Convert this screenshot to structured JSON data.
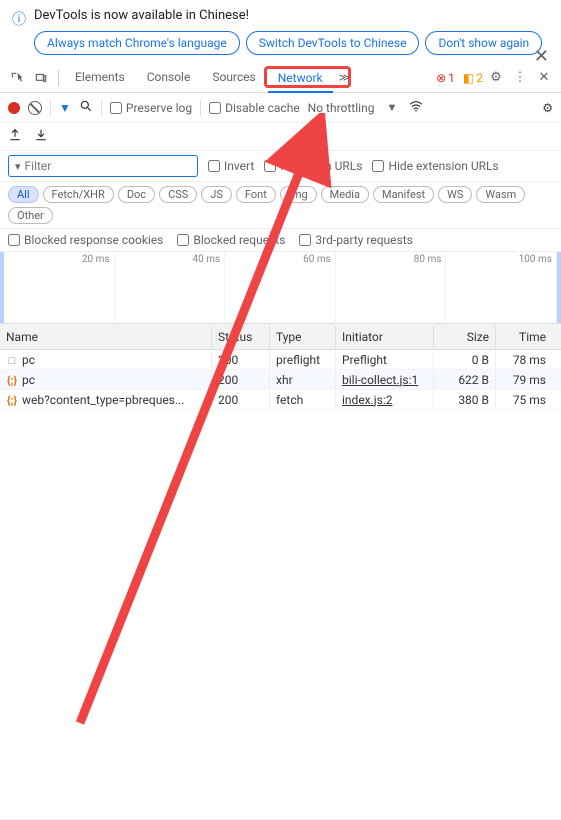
{
  "infobar": {
    "message": "DevTools is now available in Chinese!",
    "chips": [
      "Always match Chrome's language",
      "Switch DevTools to Chinese",
      "Don't show again"
    ]
  },
  "tabs": {
    "items": [
      "Elements",
      "Console",
      "Sources",
      "Network"
    ],
    "active": 3,
    "errors": "1",
    "warnings": "2"
  },
  "toolbar": {
    "preserve_log": "Preserve log",
    "disable_cache": "Disable cache",
    "throttling": "No throttling"
  },
  "filter": {
    "placeholder": "Filter",
    "invert": "Invert",
    "hide_data_urls": "Hide data URLs",
    "hide_ext_urls": "Hide extension URLs"
  },
  "types": [
    "All",
    "Fetch/XHR",
    "Doc",
    "CSS",
    "JS",
    "Font",
    "Img",
    "Media",
    "Manifest",
    "WS",
    "Wasm",
    "Other"
  ],
  "options": {
    "blocked_cookies": "Blocked response cookies",
    "blocked_requests": "Blocked requests",
    "third_party": "3rd-party requests"
  },
  "timeline": [
    "20 ms",
    "40 ms",
    "60 ms",
    "80 ms",
    "100 ms"
  ],
  "headers": {
    "name": "Name",
    "status": "Status",
    "type": "Type",
    "initiator": "Initiator",
    "size": "Size",
    "time": "Time"
  },
  "rows": [
    {
      "icon": "box",
      "name": "pc",
      "status": "200",
      "type": "preflight",
      "initiator": "Preflight",
      "initiator_link": false,
      "size": "0 B",
      "time": "78 ms"
    },
    {
      "icon": "brace",
      "name": "pc",
      "status": "200",
      "type": "xhr",
      "initiator": "bili-collect.js:1",
      "initiator_link": true,
      "size": "622 B",
      "time": "79 ms"
    },
    {
      "icon": "brace",
      "name": "web?content_type=pbreques...",
      "status": "200",
      "type": "fetch",
      "initiator": "index.js:2",
      "initiator_link": true,
      "size": "380 B",
      "time": "75 ms"
    }
  ]
}
